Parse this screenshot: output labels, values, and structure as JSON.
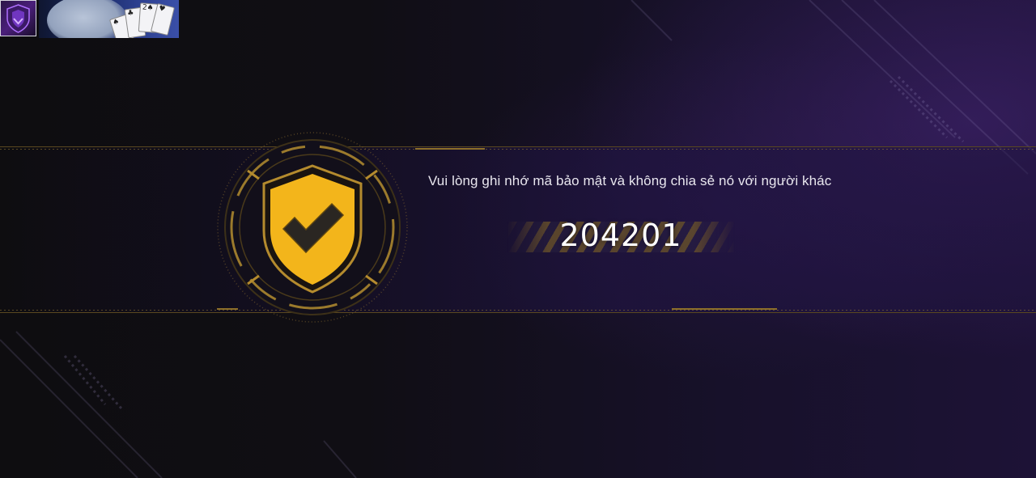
{
  "colors": {
    "accent_gold": "#f3b51b",
    "frame_gold": "#9b7a2c",
    "background": "#0d0c0f",
    "band_purple": "#201442",
    "text_light": "#e8e6ee",
    "code_white": "#ffffff"
  },
  "header": {
    "avatar_icon": "shield-avatar-icon",
    "thumbnail_icon": "playing-cards-thumbnail-icon"
  },
  "security": {
    "emblem_icon": "shield-check-icon",
    "message": "Vui lòng ghi nhớ mã bảo mật và không chia sẻ nó với người khác",
    "code": "204201"
  }
}
